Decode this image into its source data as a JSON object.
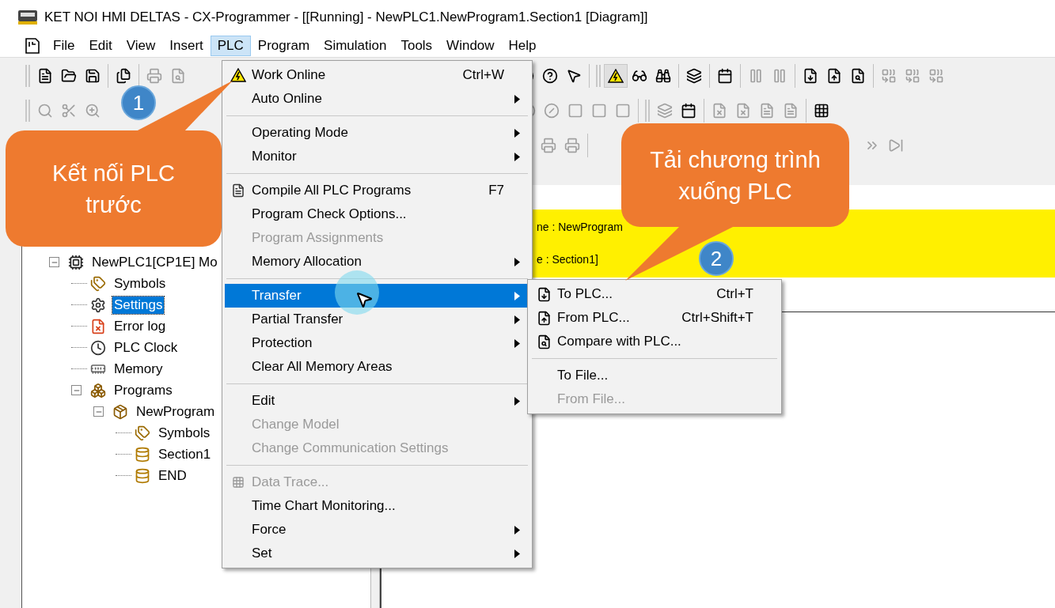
{
  "window": {
    "title": "KET NOI HMI DELTAS - CX-Programmer - [[Running] - NewPLC1.NewProgram1.Section1 [Diagram]]"
  },
  "menu_bar": [
    {
      "label": "File",
      "selected": false
    },
    {
      "label": "Edit",
      "selected": false
    },
    {
      "label": "View",
      "selected": false
    },
    {
      "label": "Insert",
      "selected": false
    },
    {
      "label": "PLC",
      "selected": true
    },
    {
      "label": "Program",
      "selected": false
    },
    {
      "label": "Simulation",
      "selected": false
    },
    {
      "label": "Tools",
      "selected": false
    },
    {
      "label": "Window",
      "selected": false
    },
    {
      "label": "Help",
      "selected": false
    }
  ],
  "plc_menu": {
    "groups": [
      {
        "items": [
          {
            "label": "Work Online",
            "shortcut": "Ctrl+W",
            "kind": "online",
            "submenu": false,
            "disabled": false,
            "selected": false
          },
          {
            "label": "Auto Online",
            "kind": "plain",
            "submenu": true,
            "disabled": false,
            "selected": false
          }
        ]
      },
      {
        "items": [
          {
            "label": "Operating Mode",
            "kind": "plain",
            "submenu": true,
            "disabled": false,
            "selected": false
          },
          {
            "label": "Monitor",
            "kind": "plain",
            "submenu": true,
            "disabled": false,
            "selected": false
          }
        ]
      },
      {
        "items": [
          {
            "label": "Compile All PLC Programs",
            "shortcut": "F7",
            "kind": "compile",
            "submenu": false,
            "disabled": false,
            "selected": false
          },
          {
            "label": "Program Check Options...",
            "kind": "plain",
            "submenu": false,
            "disabled": false,
            "selected": false
          },
          {
            "label": "Program Assignments",
            "kind": "plain",
            "submenu": false,
            "disabled": true,
            "selected": false
          },
          {
            "label": "Memory Allocation",
            "kind": "plain",
            "submenu": true,
            "disabled": false,
            "selected": false
          }
        ]
      },
      {
        "items": [
          {
            "label": "Transfer",
            "kind": "plain",
            "submenu": true,
            "disabled": false,
            "selected": true
          },
          {
            "label": "Partial Transfer",
            "kind": "plain",
            "submenu": true,
            "disabled": false,
            "selected": false
          },
          {
            "label": "Protection",
            "kind": "plain",
            "submenu": true,
            "disabled": false,
            "selected": false
          },
          {
            "label": "Clear All Memory Areas",
            "kind": "plain",
            "submenu": false,
            "disabled": false,
            "selected": false
          }
        ]
      },
      {
        "items": [
          {
            "label": "Edit",
            "kind": "plain",
            "submenu": true,
            "disabled": false,
            "selected": false
          },
          {
            "label": "Change Model",
            "kind": "plain",
            "submenu": false,
            "disabled": true,
            "selected": false
          },
          {
            "label": "Change Communication Settings",
            "kind": "plain",
            "submenu": false,
            "disabled": true,
            "selected": false
          }
        ]
      },
      {
        "items": [
          {
            "label": "Data Trace...",
            "kind": "trace",
            "submenu": false,
            "disabled": true,
            "selected": false
          },
          {
            "label": "Time Chart Monitoring...",
            "kind": "plain",
            "submenu": false,
            "disabled": false,
            "selected": false
          },
          {
            "label": "Force",
            "kind": "plain",
            "submenu": true,
            "disabled": false,
            "selected": false
          },
          {
            "label": "Set",
            "kind": "plain",
            "submenu": true,
            "disabled": false,
            "selected": false
          }
        ]
      }
    ]
  },
  "transfer_submenu": {
    "groups": [
      {
        "items": [
          {
            "label": "To PLC...",
            "shortcut": "Ctrl+T",
            "kind": "download",
            "disabled": false
          },
          {
            "label": "From PLC...",
            "shortcut": "Ctrl+Shift+T",
            "kind": "upload",
            "disabled": false
          },
          {
            "label": "Compare with PLC...",
            "kind": "compare",
            "disabled": false
          }
        ]
      },
      {
        "items": [
          {
            "label": "To File...",
            "kind": "plain",
            "disabled": false
          },
          {
            "label": "From File...",
            "kind": "plain",
            "disabled": true
          }
        ]
      }
    ]
  },
  "project_tree": {
    "items": [
      {
        "label": "NewPLC1[CP1E] Mo",
        "kind": "plc",
        "expanded": true,
        "selected": false,
        "children": [
          {
            "label": "Symbols",
            "kind": "symbols",
            "selected": false
          },
          {
            "label": "Settings",
            "kind": "settings",
            "selected": true
          },
          {
            "label": "Error log",
            "kind": "errorlog",
            "selected": false
          },
          {
            "label": "PLC Clock",
            "kind": "clock",
            "selected": false
          },
          {
            "label": "Memory",
            "kind": "memory",
            "selected": false
          },
          {
            "label": "Programs",
            "kind": "programs",
            "expanded": true,
            "selected": false,
            "children": [
              {
                "label": "NewProgram",
                "kind": "program",
                "expanded": true,
                "selected": false,
                "children": [
                  {
                    "label": "Symbols",
                    "kind": "symbols",
                    "selected": false
                  },
                  {
                    "label": "Section1",
                    "kind": "section",
                    "selected": false
                  },
                  {
                    "label": "END",
                    "kind": "section",
                    "selected": false
                  }
                ]
              }
            ]
          }
        ]
      }
    ]
  },
  "diagram": {
    "header_lines": [
      "ne : NewProgram",
      "e : Section1]"
    ]
  },
  "callouts": [
    {
      "text": "Kết nối PLC trước",
      "badge": "1"
    },
    {
      "text": "Tải chương trình xuống PLC",
      "badge": "2"
    }
  ]
}
